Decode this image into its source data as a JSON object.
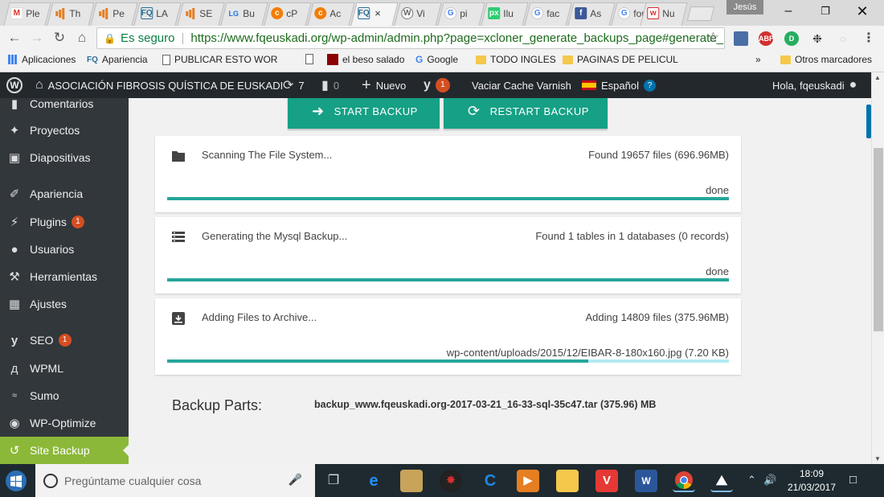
{
  "browser": {
    "tabs": [
      {
        "label": "Ple",
        "icon": "gmail-icon"
      },
      {
        "label": "Th",
        "icon": "analytics-icon"
      },
      {
        "label": "Pe",
        "icon": "analytics-icon"
      },
      {
        "label": "LA",
        "icon": "fq-icon"
      },
      {
        "label": "SE",
        "icon": "analytics-icon"
      },
      {
        "label": "Bu",
        "icon": "lg-icon"
      },
      {
        "label": "cP",
        "icon": "cpanel-icon"
      },
      {
        "label": "Ac",
        "icon": "cpanel-icon"
      },
      {
        "label": "",
        "icon": "fq-icon",
        "active": true,
        "close": "×"
      },
      {
        "label": "Vi",
        "icon": "wordpress-icon"
      },
      {
        "label": "pi",
        "icon": "google-icon"
      },
      {
        "label": "Ilu",
        "icon": "pixlr-icon"
      },
      {
        "label": "fac",
        "icon": "google-icon"
      },
      {
        "label": "As",
        "icon": "facebook-icon"
      },
      {
        "label": "for",
        "icon": "google-icon"
      },
      {
        "label": "Nu",
        "icon": "w-icon"
      }
    ],
    "profile_name": "Jesús",
    "secure_label": "Es seguro",
    "url": "https://www.fqeuskadi.org/wp-admin/admin.php?page=xcloner_generate_backups_page#generate_backups",
    "bookmarks": [
      {
        "label": "Aplicaciones",
        "icon": "apps-icon"
      },
      {
        "label": "Apariencia",
        "icon": "fq-icon"
      },
      {
        "label": "PUBLICAR ESTO WOR",
        "icon": "page-icon"
      },
      {
        "label": "",
        "icon": "page-icon"
      },
      {
        "label": "el beso salado",
        "icon": "beso-icon"
      },
      {
        "label": "Google",
        "icon": "google-icon"
      },
      {
        "label": "TODO INGLES",
        "icon": "folder-icon"
      },
      {
        "label": "PAGINAS DE PELICUL",
        "icon": "folder-icon"
      }
    ],
    "bookmarks_more": "»",
    "other_bookmarks": "Otros marcadores"
  },
  "adminbar": {
    "site_name": "ASOCIACIÓN FIBROSIS QUÍSTICA DE EUSKADI",
    "updates_count": "7",
    "comments_count": "0",
    "new_label": "Nuevo",
    "yoast_badge": "1",
    "varnish_label": "Vaciar Cache Varnish",
    "language_label": "Español",
    "greeting": "Hola, fqeuskadi"
  },
  "sidebar": {
    "items": [
      {
        "label": "Comentarios",
        "icon": "comments-icon"
      },
      {
        "label": "Proyectos",
        "icon": "pin-icon"
      },
      {
        "label": "Diapositivas",
        "icon": "slides-icon"
      },
      {
        "label": "Apariencia",
        "icon": "brush-icon"
      },
      {
        "label": "Plugins",
        "icon": "plugin-icon",
        "badge": "1"
      },
      {
        "label": "Usuarios",
        "icon": "users-icon"
      },
      {
        "label": "Herramientas",
        "icon": "wrench-icon"
      },
      {
        "label": "Ajustes",
        "icon": "settings-icon"
      },
      {
        "label": "SEO",
        "icon": "yoast-icon",
        "badge": "1"
      },
      {
        "label": "WPML",
        "icon": "wpml-icon"
      },
      {
        "label": "Sumo",
        "icon": "sumo-icon"
      },
      {
        "label": "WP-Optimize",
        "icon": "optimize-icon"
      },
      {
        "label": "Site Backup",
        "icon": "backup-icon",
        "current": true
      }
    ]
  },
  "main": {
    "start_backup_label": "START BACKUP",
    "restart_backup_label": "RESTART BACKUP",
    "steps": [
      {
        "title": "Scanning The File System...",
        "summary": "Found 19657 files (696.96MB)",
        "status": "done",
        "progress": 1.0,
        "icon": "folder-icon"
      },
      {
        "title": "Generating the Mysql Backup...",
        "summary": "Found 1 tables in 1 databases (0 records)",
        "status": "done",
        "progress": 1.0,
        "icon": "database-icon"
      },
      {
        "title": "Adding Files to Archive...",
        "summary": "Adding 14809 files (375.96MB)",
        "status": "wp-content/uploads/2015/12/EIBAR-8-180x160.jpg (7.20 KB)",
        "progress": 0.75,
        "icon": "archive-icon"
      }
    ],
    "backup_parts_label": "Backup Parts:",
    "backup_parts_value": "backup_www.fqeuskadi.org-2017-03-21_16-33-sql-35c47.tar (375.96) MB"
  },
  "taskbar": {
    "search_placeholder": "Pregúntame cualquier cosa",
    "time": "18:09",
    "date": "21/03/2017"
  },
  "colors": {
    "accent_green": "#16a085",
    "progress": "#26a69a",
    "progress_track": "#b2ebf2",
    "wp_sidebar": "#32373c",
    "wp_adminbar": "#23282d",
    "current_menu": "#8bb838",
    "badge": "#d54e21"
  }
}
